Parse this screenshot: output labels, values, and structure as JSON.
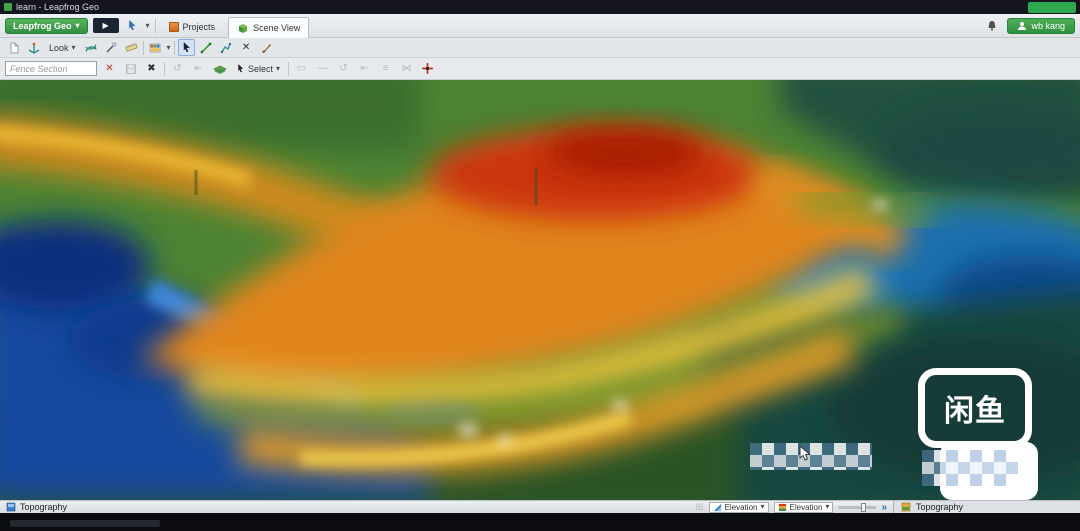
{
  "window": {
    "title": "learn - Leapfrog Geo"
  },
  "menubar": {
    "app_button_label": "Leapfrog Geo",
    "tabs": [
      {
        "label": "Projects"
      },
      {
        "label": "Scene View"
      }
    ],
    "user_name": "wb kang"
  },
  "toolbars": {
    "look_label": "Look",
    "select_label": "Select",
    "fence_placeholder": "Fence Section"
  },
  "statusbar": {
    "shape_label": "Topography",
    "view_dropdown": "Elevation",
    "colour_dropdown": "Elevation",
    "panel_title": "Topography"
  },
  "watermark_text": "闲鱼",
  "icons": {
    "caret": "▾",
    "play": "▶",
    "close_red": "✕",
    "delete": "✖",
    "grid": "⊞",
    "arrows_fwd": "»",
    "x_tool": "✕",
    "d1": "▭",
    "d2": "—",
    "d3": "↺",
    "d4": "⇤",
    "d5": "≡",
    "d6": "⋈"
  },
  "colors": {
    "brand_green": "#3fa24b",
    "titlebar_badge_green": "#2ea84e",
    "active_tool_blue": "#d2e3f8",
    "elevation_low_blue": "#2f7fd0",
    "elevation_high_orange": "#e0851c"
  }
}
